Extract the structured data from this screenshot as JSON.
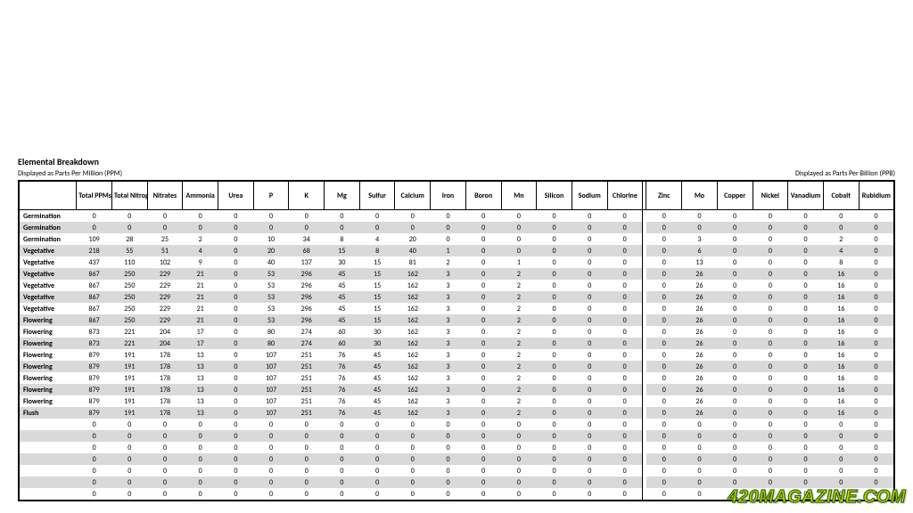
{
  "title": "Elemental Breakdown",
  "subtitle_left": "Displayed as Parts Per Million (PPM)",
  "subtitle_right": "Displayed as Parts Per Billion (PPB)",
  "watermark": "420MAGAZINE.COM",
  "headers_main": [
    "",
    "Total PPMs",
    "Total Nitrogen",
    "Nitrates",
    "Ammonia",
    "Urea",
    "P",
    "K",
    "Mg",
    "Sulfur",
    "Calcium",
    "Iron",
    "Boron",
    "Mn",
    "Silicon",
    "Sodium",
    "Chlorine"
  ],
  "headers_ppb": [
    "Zinc",
    "Mo",
    "Copper",
    "Nickel",
    "Vanadium",
    "Cobalt",
    "Rubidium"
  ],
  "chart_data": {
    "type": "table",
    "rows": [
      {
        "stage": "Germination",
        "main": [
          0,
          0,
          0,
          0,
          0,
          0,
          0,
          0,
          0,
          0,
          0,
          0,
          0,
          0,
          0,
          0
        ],
        "ppb": [
          0,
          0,
          0,
          0,
          0,
          0,
          0
        ]
      },
      {
        "stage": "Germination",
        "main": [
          0,
          0,
          0,
          0,
          0,
          0,
          0,
          0,
          0,
          0,
          0,
          0,
          0,
          0,
          0,
          0
        ],
        "ppb": [
          0,
          0,
          0,
          0,
          0,
          0,
          0
        ]
      },
      {
        "stage": "Germination",
        "main": [
          109,
          28,
          25,
          2,
          0,
          10,
          34,
          8,
          4,
          20,
          0,
          0,
          0,
          0,
          0,
          0
        ],
        "ppb": [
          0,
          3,
          0,
          0,
          0,
          2,
          0
        ]
      },
      {
        "stage": "Vegetative",
        "main": [
          218,
          55,
          51,
          4,
          0,
          20,
          68,
          15,
          8,
          40,
          1,
          0,
          0,
          0,
          0,
          0
        ],
        "ppb": [
          0,
          6,
          0,
          0,
          0,
          4,
          0
        ]
      },
      {
        "stage": "Vegetative",
        "main": [
          437,
          110,
          102,
          9,
          0,
          40,
          137,
          30,
          15,
          81,
          2,
          0,
          1,
          0,
          0,
          0
        ],
        "ppb": [
          0,
          13,
          0,
          0,
          0,
          8,
          0
        ]
      },
      {
        "stage": "Vegetative",
        "main": [
          867,
          250,
          229,
          21,
          0,
          53,
          296,
          45,
          15,
          162,
          3,
          0,
          2,
          0,
          0,
          0
        ],
        "ppb": [
          0,
          26,
          0,
          0,
          0,
          16,
          0
        ]
      },
      {
        "stage": "Vegetative",
        "main": [
          867,
          250,
          229,
          21,
          0,
          53,
          296,
          45,
          15,
          162,
          3,
          0,
          2,
          0,
          0,
          0
        ],
        "ppb": [
          0,
          26,
          0,
          0,
          0,
          16,
          0
        ]
      },
      {
        "stage": "Vegetative",
        "main": [
          867,
          250,
          229,
          21,
          0,
          53,
          296,
          45,
          15,
          162,
          3,
          0,
          2,
          0,
          0,
          0
        ],
        "ppb": [
          0,
          26,
          0,
          0,
          0,
          16,
          0
        ]
      },
      {
        "stage": "Vegetative",
        "main": [
          867,
          250,
          229,
          21,
          0,
          53,
          296,
          45,
          15,
          162,
          3,
          0,
          2,
          0,
          0,
          0
        ],
        "ppb": [
          0,
          26,
          0,
          0,
          0,
          16,
          0
        ]
      },
      {
        "stage": "Flowering",
        "main": [
          867,
          250,
          229,
          21,
          0,
          53,
          296,
          45,
          15,
          162,
          3,
          0,
          2,
          0,
          0,
          0
        ],
        "ppb": [
          0,
          26,
          0,
          0,
          0,
          16,
          0
        ]
      },
      {
        "stage": "Flowering",
        "main": [
          873,
          221,
          204,
          17,
          0,
          80,
          274,
          60,
          30,
          162,
          3,
          0,
          2,
          0,
          0,
          0
        ],
        "ppb": [
          0,
          26,
          0,
          0,
          0,
          16,
          0
        ]
      },
      {
        "stage": "Flowering",
        "main": [
          873,
          221,
          204,
          17,
          0,
          80,
          274,
          60,
          30,
          162,
          3,
          0,
          2,
          0,
          0,
          0
        ],
        "ppb": [
          0,
          26,
          0,
          0,
          0,
          16,
          0
        ]
      },
      {
        "stage": "Flowering",
        "main": [
          879,
          191,
          178,
          13,
          0,
          107,
          251,
          76,
          45,
          162,
          3,
          0,
          2,
          0,
          0,
          0
        ],
        "ppb": [
          0,
          26,
          0,
          0,
          0,
          16,
          0
        ]
      },
      {
        "stage": "Flowering",
        "main": [
          879,
          191,
          178,
          13,
          0,
          107,
          251,
          76,
          45,
          162,
          3,
          0,
          2,
          0,
          0,
          0
        ],
        "ppb": [
          0,
          26,
          0,
          0,
          0,
          16,
          0
        ]
      },
      {
        "stage": "Flowering",
        "main": [
          879,
          191,
          178,
          13,
          0,
          107,
          251,
          76,
          45,
          162,
          3,
          0,
          2,
          0,
          0,
          0
        ],
        "ppb": [
          0,
          26,
          0,
          0,
          0,
          16,
          0
        ]
      },
      {
        "stage": "Flowering",
        "main": [
          879,
          191,
          178,
          13,
          0,
          107,
          251,
          76,
          45,
          162,
          3,
          0,
          2,
          0,
          0,
          0
        ],
        "ppb": [
          0,
          26,
          0,
          0,
          0,
          16,
          0
        ]
      },
      {
        "stage": "Flowering",
        "main": [
          879,
          191,
          178,
          13,
          0,
          107,
          251,
          76,
          45,
          162,
          3,
          0,
          2,
          0,
          0,
          0
        ],
        "ppb": [
          0,
          26,
          0,
          0,
          0,
          16,
          0
        ]
      },
      {
        "stage": "Flush",
        "main": [
          879,
          191,
          178,
          13,
          0,
          107,
          251,
          76,
          45,
          162,
          3,
          0,
          2,
          0,
          0,
          0
        ],
        "ppb": [
          0,
          26,
          0,
          0,
          0,
          16,
          0
        ]
      },
      {
        "stage": "",
        "main": [
          0,
          0,
          0,
          0,
          0,
          0,
          0,
          0,
          0,
          0,
          0,
          0,
          0,
          0,
          0,
          0
        ],
        "ppb": [
          0,
          0,
          0,
          0,
          0,
          0,
          0
        ]
      },
      {
        "stage": "",
        "main": [
          0,
          0,
          0,
          0,
          0,
          0,
          0,
          0,
          0,
          0,
          0,
          0,
          0,
          0,
          0,
          0
        ],
        "ppb": [
          0,
          0,
          0,
          0,
          0,
          0,
          0
        ]
      },
      {
        "stage": "",
        "main": [
          0,
          0,
          0,
          0,
          0,
          0,
          0,
          0,
          0,
          0,
          0,
          0,
          0,
          0,
          0,
          0
        ],
        "ppb": [
          0,
          0,
          0,
          0,
          0,
          0,
          0
        ]
      },
      {
        "stage": "",
        "main": [
          0,
          0,
          0,
          0,
          0,
          0,
          0,
          0,
          0,
          0,
          0,
          0,
          0,
          0,
          0,
          0
        ],
        "ppb": [
          0,
          0,
          0,
          0,
          0,
          0,
          0
        ]
      },
      {
        "stage": "",
        "main": [
          0,
          0,
          0,
          0,
          0,
          0,
          0,
          0,
          0,
          0,
          0,
          0,
          0,
          0,
          0,
          0
        ],
        "ppb": [
          0,
          0,
          0,
          0,
          0,
          0,
          0
        ]
      },
      {
        "stage": "",
        "main": [
          0,
          0,
          0,
          0,
          0,
          0,
          0,
          0,
          0,
          0,
          0,
          0,
          0,
          0,
          0,
          0
        ],
        "ppb": [
          0,
          0,
          0,
          0,
          0,
          0,
          0
        ]
      },
      {
        "stage": "",
        "main": [
          0,
          0,
          0,
          0,
          0,
          0,
          0,
          0,
          0,
          0,
          0,
          0,
          0,
          0,
          0,
          0
        ],
        "ppb": [
          0,
          0,
          0,
          0,
          0,
          0,
          0
        ]
      }
    ]
  }
}
